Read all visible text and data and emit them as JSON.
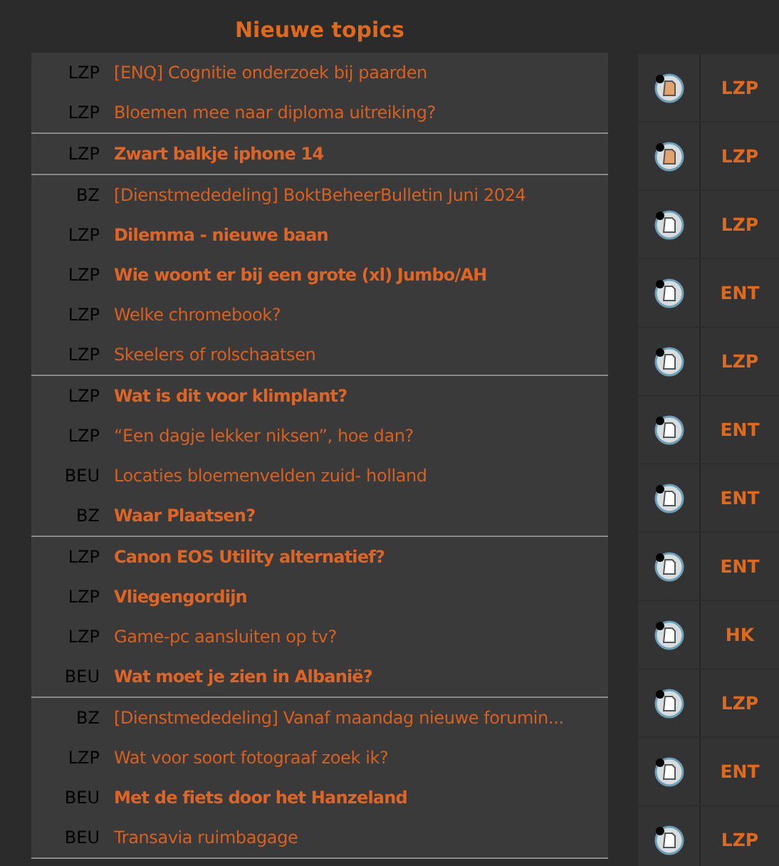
{
  "title": "Nieuwe topics",
  "topic_groups": [
    [
      {
        "category": "LZP",
        "title": "[ENQ] Cognitie onderzoek bij paarden",
        "unread": false
      },
      {
        "category": "LZP",
        "title": "Bloemen mee naar diploma uitreiking?",
        "unread": false
      }
    ],
    [
      {
        "category": "LZP",
        "title": "Zwart balkje iphone 14",
        "unread": true
      }
    ],
    [
      {
        "category": "BZ",
        "title": "[Dienstmededeling] BoktBeheerBulletin Juni 2024",
        "unread": false
      },
      {
        "category": "LZP",
        "title": "Dilemma - nieuwe baan",
        "unread": true
      },
      {
        "category": "LZP",
        "title": "Wie woont er bij een grote (xl) Jumbo/AH",
        "unread": true
      },
      {
        "category": "LZP",
        "title": "Welke chromebook?",
        "unread": false
      },
      {
        "category": "LZP",
        "title": "Skeelers of rolschaatsen",
        "unread": false
      }
    ],
    [
      {
        "category": "LZP",
        "title": "Wat is dit voor klimplant?",
        "unread": true
      },
      {
        "category": "LZP",
        "title": "“Een dagje lekker niksen”, hoe dan?",
        "unread": false
      },
      {
        "category": "BEU",
        "title": "Locaties bloemenvelden zuid- holland",
        "unread": false
      },
      {
        "category": "BZ",
        "title": "Waar Plaatsen?",
        "unread": true
      }
    ],
    [
      {
        "category": "LZP",
        "title": "Canon EOS Utility alternatief?",
        "unread": true
      },
      {
        "category": "LZP",
        "title": "Vliegengordijn",
        "unread": true
      },
      {
        "category": "LZP",
        "title": "Game-pc aansluiten op tv?",
        "unread": false
      },
      {
        "category": "BEU",
        "title": "Wat moet je zien in Albanië?",
        "unread": true
      }
    ],
    [
      {
        "category": "BZ",
        "title": "[Dienstmededeling] Vanaf maandag nieuwe forumin...",
        "unread": false
      },
      {
        "category": "LZP",
        "title": "Wat voor soort fotograaf zoek ik?",
        "unread": false
      },
      {
        "category": "BEU",
        "title": "Met de fiets door het Hanzeland",
        "unread": true
      },
      {
        "category": "BEU",
        "title": "Transavia ruimbagage",
        "unread": false
      }
    ]
  ],
  "side_items": [
    {
      "highlighted": true,
      "label": "LZP"
    },
    {
      "highlighted": true,
      "label": "LZP"
    },
    {
      "highlighted": false,
      "label": "LZP"
    },
    {
      "highlighted": false,
      "label": "ENT"
    },
    {
      "highlighted": false,
      "label": "LZP"
    },
    {
      "highlighted": false,
      "label": "ENT"
    },
    {
      "highlighted": false,
      "label": "ENT"
    },
    {
      "highlighted": false,
      "label": "ENT"
    },
    {
      "highlighted": false,
      "label": "HK"
    },
    {
      "highlighted": false,
      "label": "LZP"
    },
    {
      "highlighted": false,
      "label": "ENT"
    },
    {
      "highlighted": false,
      "label": "LZP"
    }
  ]
}
